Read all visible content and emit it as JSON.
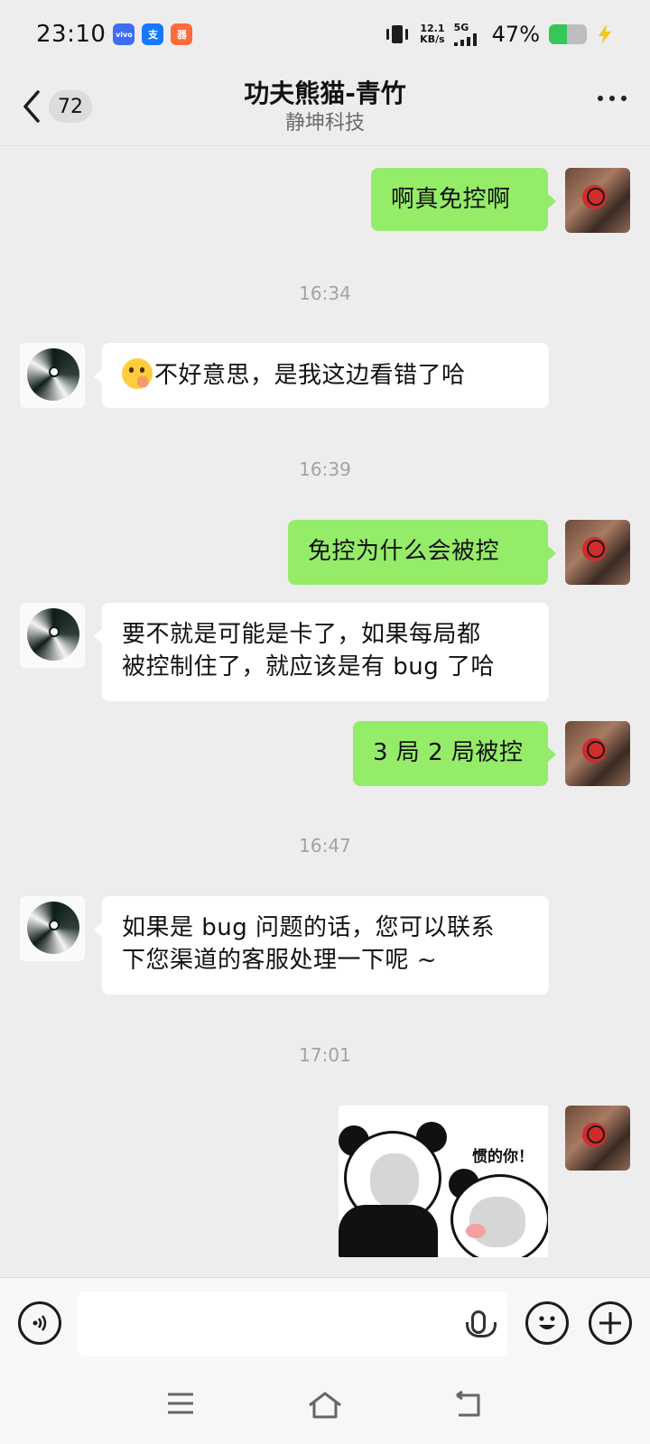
{
  "status_bar": {
    "time": "23:10",
    "app_badges": [
      {
        "label": "vivo",
        "color": "#3d6cf5"
      },
      {
        "label": "支",
        "color": "#1677ff"
      },
      {
        "label": "器",
        "color": "#ff6a3d"
      }
    ],
    "net_speed_value": "12.1",
    "net_speed_unit": "KB/s",
    "network_type": "5G",
    "battery_percent": "47%",
    "battery_level": 0.47,
    "icons": [
      "vibrate-icon",
      "signal-icon",
      "battery-icon",
      "charging-icon"
    ]
  },
  "header": {
    "unread_count": "72",
    "title": "功夫熊猫-青竹",
    "subtitle": "静坤科技",
    "icons": [
      "back-chevron-icon",
      "more-dots-icon"
    ]
  },
  "messages": [
    {
      "sender": "me",
      "text": "啊真免控啊"
    },
    {
      "type": "timestamp",
      "text": "16:34"
    },
    {
      "sender": "them",
      "text": "不好意思，是我这边看错了哈",
      "emoji": "hand-over-mouth-emoji"
    },
    {
      "type": "timestamp",
      "text": "16:39"
    },
    {
      "sender": "me",
      "text": "免控为什么会被控"
    },
    {
      "sender": "them",
      "line1": "要不就是可能是卡了，如果每局都",
      "line2": "被控制住了，就应该是有 bug 了哈"
    },
    {
      "sender": "me",
      "text": "3 局 2 局被控"
    },
    {
      "type": "timestamp",
      "text": "16:47"
    },
    {
      "sender": "them",
      "line1": "如果是 bug 问题的话，您可以联系",
      "line2": "下您渠道的客服处理一下呢 ~"
    },
    {
      "type": "timestamp",
      "text": "17:01"
    },
    {
      "sender": "me",
      "sticker_caption": "惯的你！"
    }
  ],
  "input_bar": {
    "value": "",
    "icons": [
      "voice-mode-icon",
      "mic-icon",
      "emoji-icon",
      "plus-icon"
    ]
  },
  "system_nav": {
    "icons": [
      "menu-icon",
      "home-icon",
      "back-icon"
    ]
  },
  "colors": {
    "background": "#ededed",
    "my_bubble": "#95ec69",
    "their_bubble": "#ffffff"
  }
}
